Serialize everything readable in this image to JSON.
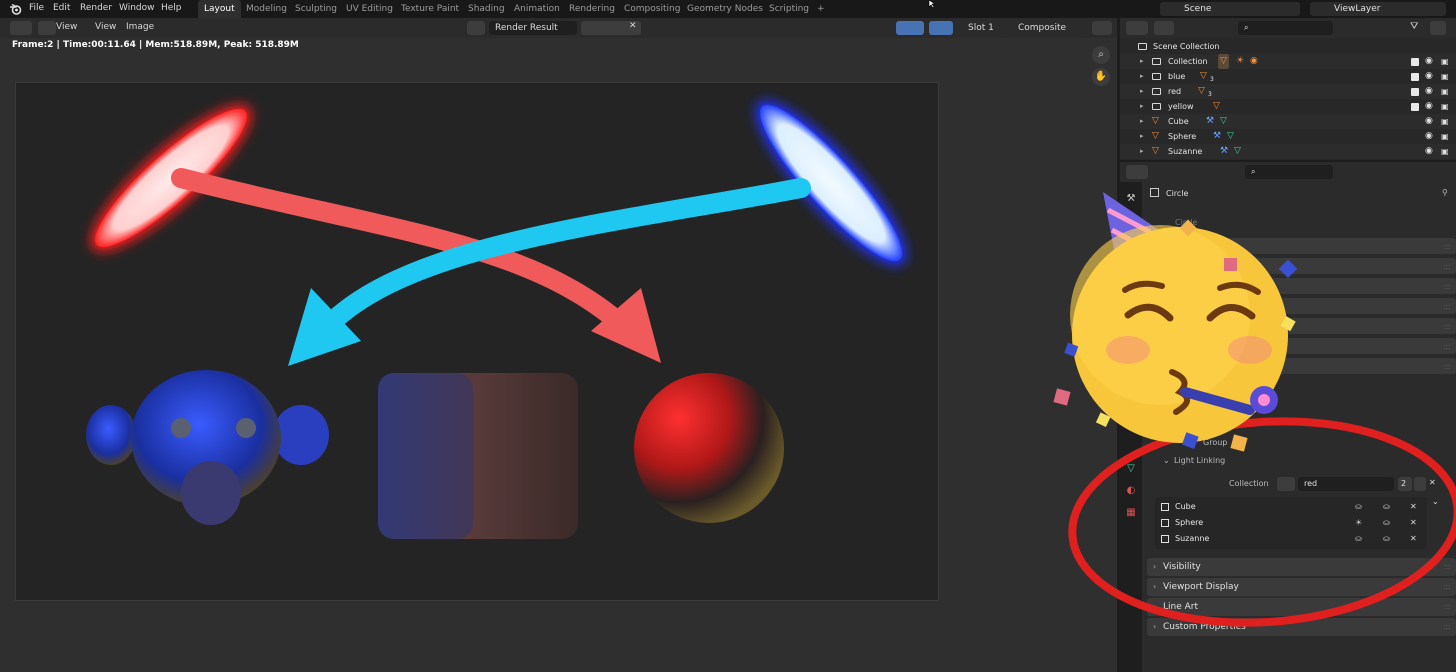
{
  "menu": {
    "file": "File",
    "edit": "Edit",
    "render": "Render",
    "window": "Window",
    "help": "Help"
  },
  "workspaces": [
    "Layout",
    "Modeling",
    "Sculpting",
    "UV Editing",
    "Texture Paint",
    "Shading",
    "Animation",
    "Rendering",
    "Compositing",
    "Geometry Nodes",
    "Scripting",
    "+"
  ],
  "scene": {
    "name": "Scene",
    "view_layer": "ViewLayer"
  },
  "image_editor": {
    "header": {
      "view": "View",
      "view2": "View",
      "image": "Image",
      "image_name": "Render Result",
      "slot": "Slot 1",
      "pass": "Composite"
    },
    "info": "Frame:2 | Time:00:11.64 | Mem:518.89M, Peak: 518.89M"
  },
  "outliner": {
    "root": "Scene Collection",
    "rows": [
      {
        "label": "Collection"
      },
      {
        "label": "blue",
        "count": "3"
      },
      {
        "label": "red",
        "count": "3"
      },
      {
        "label": "yellow"
      },
      {
        "label": "Cube"
      },
      {
        "label": "Sphere"
      },
      {
        "label": "Suzanne"
      }
    ]
  },
  "properties": {
    "object_name": "Circle",
    "data_name": "Circle",
    "group_label": "Group",
    "light_linking_label": "Light Linking",
    "collection_label": "Collection",
    "collection_value": "red",
    "user_count": "2",
    "linked_objects": [
      "Cube",
      "Sphere",
      "Suzanne"
    ],
    "panels": [
      "Visibility",
      "Viewport Display",
      "Line Art",
      "Custom Properties"
    ]
  },
  "colors": {
    "accent_blue": "#4772b3",
    "arrow_red": "#f05a5a",
    "arrow_cyan": "#1ec8f0",
    "annotation_red": "#e0201e",
    "active_tab": "#2f2f2f"
  },
  "icons": [
    "blender-logo",
    "search-icon",
    "filter-icon",
    "eye-icon",
    "camera-icon",
    "checkbox-icon",
    "zoom-icon",
    "hand-icon",
    "close-icon",
    "pin-icon",
    "party-face-emoji"
  ]
}
